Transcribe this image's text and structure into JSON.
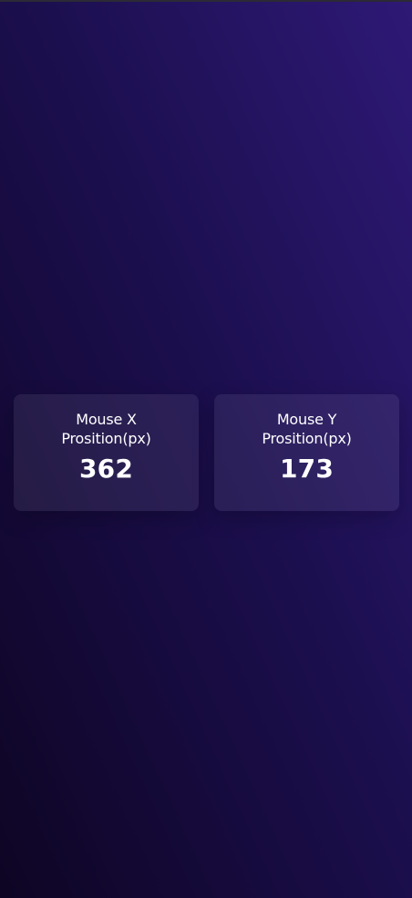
{
  "stats": [
    {
      "label": "Mouse X Prosition(px)",
      "value": "362"
    },
    {
      "label": "Mouse Y Prosition(px)",
      "value": "173"
    }
  ]
}
